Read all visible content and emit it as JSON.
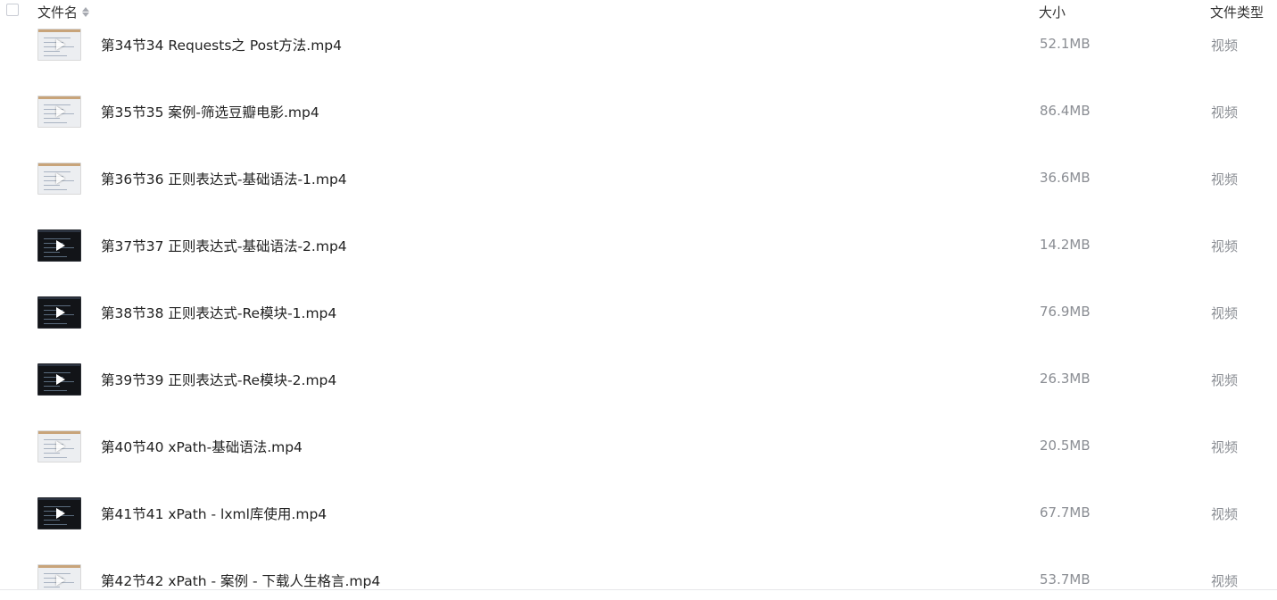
{
  "header": {
    "name_label": "文件名",
    "size_label": "大小",
    "type_label": "文件类型",
    "sort_icon": "sort-icon"
  },
  "files": [
    {
      "name": "第34节34 Requests之 Post方法.mp4",
      "size": "52.1MB",
      "type": "视频",
      "thumb": "light"
    },
    {
      "name": "第35节35 案例-筛选豆瓣电影.mp4",
      "size": "86.4MB",
      "type": "视频",
      "thumb": "light"
    },
    {
      "name": "第36节36 正则表达式-基础语法-1.mp4",
      "size": "36.6MB",
      "type": "视频",
      "thumb": "light"
    },
    {
      "name": "第37节37 正则表达式-基础语法-2.mp4",
      "size": "14.2MB",
      "type": "视频",
      "thumb": "dark"
    },
    {
      "name": "第38节38 正则表达式-Re模块-1.mp4",
      "size": "76.9MB",
      "type": "视频",
      "thumb": "dark"
    },
    {
      "name": "第39节39 正则表达式-Re模块-2.mp4",
      "size": "26.3MB",
      "type": "视频",
      "thumb": "dark"
    },
    {
      "name": "第40节40 xPath-基础语法.mp4",
      "size": "20.5MB",
      "type": "视频",
      "thumb": "light"
    },
    {
      "name": "第41节41 xPath - lxml库使用.mp4",
      "size": "67.7MB",
      "type": "视频",
      "thumb": "dark"
    },
    {
      "name": "第42节42 xPath - 案例 - 下载人生格言.mp4",
      "size": "53.7MB",
      "type": "视频",
      "thumb": "light"
    }
  ]
}
